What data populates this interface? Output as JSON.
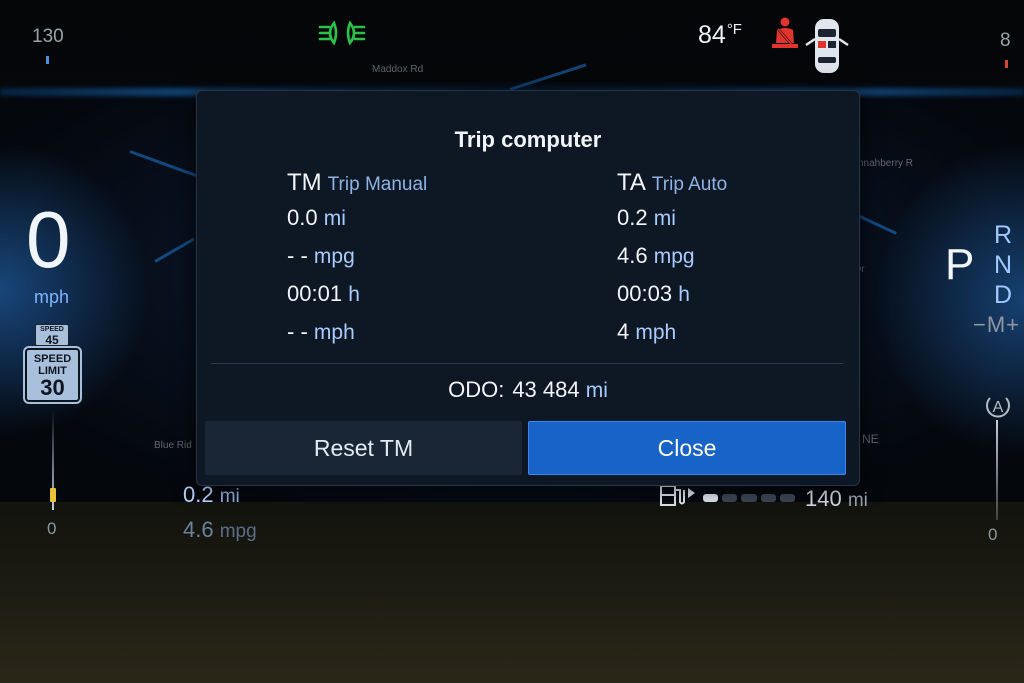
{
  "top_bar": {
    "speed_scale": "130",
    "tach_scale": "8",
    "outside_temp": "84",
    "temp_unit": "°F",
    "icons": [
      "headlight-indicator-icon",
      "seatbelt-warning-icon",
      "car-doors-icon"
    ]
  },
  "left_cluster": {
    "speed": "0",
    "speed_unit": "mph",
    "small_sign": {
      "label": "SPEED",
      "value": "45"
    },
    "speed_limit_sign": {
      "label_line1": "SPEED",
      "label_line2": "LIMIT",
      "value": "30"
    },
    "gauge_zero": "0"
  },
  "right_cluster": {
    "gear_current": "P",
    "gear_options": [
      "R",
      "N",
      "D"
    ],
    "manual_shift": "−M+",
    "auto_icon": "A",
    "gauge_zero": "0"
  },
  "map_labels": [
    "Maddox Rd",
    "Blue Rid",
    "nnahberry R",
    "Dr",
    "d NE"
  ],
  "lower_info": {
    "distance_value": "0.2",
    "distance_unit": "mi",
    "economy_value": "4.6",
    "economy_unit": "mpg",
    "range_value": "140",
    "range_unit": "mi",
    "fuel_level_segments_filled": 1,
    "fuel_level_segments_total": 5
  },
  "dialog": {
    "title": "Trip computer",
    "trip_manual": {
      "abbr": "TM",
      "name": "Trip Manual",
      "rows": [
        {
          "value": "0.0",
          "unit": "mi"
        },
        {
          "value": "- -",
          "unit": "mpg"
        },
        {
          "value": "00:01",
          "unit": "h"
        },
        {
          "value": "- -",
          "unit": "mph"
        }
      ]
    },
    "trip_auto": {
      "abbr": "TA",
      "name": "Trip Auto",
      "rows": [
        {
          "value": "0.2",
          "unit": "mi"
        },
        {
          "value": "4.6",
          "unit": "mpg"
        },
        {
          "value": "00:03",
          "unit": "h"
        },
        {
          "value": "4",
          "unit": "mph"
        }
      ]
    },
    "odometer": {
      "label": "ODO:",
      "value": "43 484",
      "unit": "mi"
    },
    "buttons": {
      "reset": "Reset TM",
      "close": "Close"
    }
  },
  "colors": {
    "accent_blue": "#1763c7",
    "dialog_bg": "#0e1724",
    "headlight_green": "#2bc24a",
    "seatbelt_red": "#e0342c",
    "unit_blue": "#a9ccff"
  }
}
